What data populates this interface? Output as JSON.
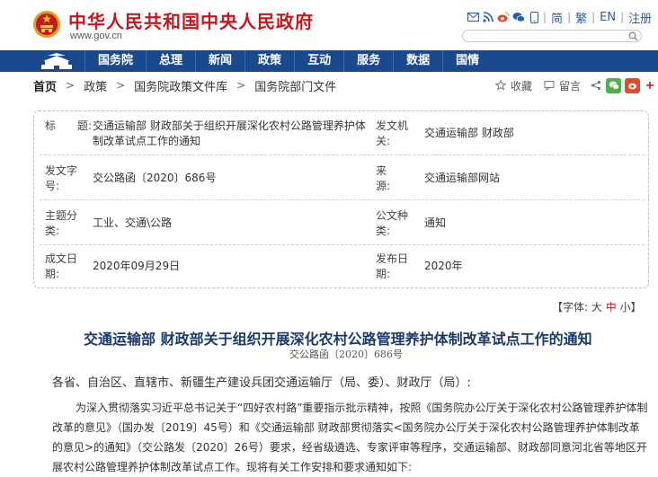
{
  "header": {
    "site_title": "中华人民共和国中央人民政府",
    "site_url": "www.gov.cn",
    "links": {
      "simplified": "简",
      "traditional": "繁",
      "english": "EN",
      "register": "注册"
    },
    "icons": [
      "mail-icon",
      "rss-icon",
      "weibo-icon",
      "wechat-icon",
      "mobile-icon"
    ]
  },
  "nav": {
    "items": [
      "国务院",
      "总理",
      "新闻",
      "政策",
      "互动",
      "服务",
      "数据",
      "国情"
    ]
  },
  "breadcrumb": {
    "home": "首页",
    "items": [
      "政策",
      "国务院政策文件库",
      "国务院部门文件"
    ]
  },
  "actions": {
    "favorite": "收藏",
    "comment": "留言"
  },
  "info": {
    "title_label": "标　　题:",
    "title_value_line1": "交通运输部 财政部关于组织开展深化农村公路管理养护体",
    "title_value_line2": "制改革试点工作的通知",
    "issuer_label_line1": "发文机",
    "issuer_label_line2": "关:",
    "issuer_value": "交通运输部 财政部",
    "docno_label_line1": "发文字",
    "docno_label_line2": "号:",
    "docno_value": "交公路函〔2020〕686号",
    "source_label_line1": "来　　",
    "source_label_line2": "源:",
    "source_value": "交通运输部网站",
    "topic_label_line1": "主题分",
    "topic_label_line2": "类:",
    "topic_value": "工业、交通\\公路",
    "genre_label_line1": "公文种",
    "genre_label_line2": "类:",
    "genre_value": "通知",
    "created_label_line1": "成文日",
    "created_label_line2": "期:",
    "created_value": "2020年09月29日",
    "published_label_line1": "发布日",
    "published_label_line2": "期:",
    "published_value": "2020年"
  },
  "fontbar": {
    "prefix": "【字体:",
    "large": "大",
    "medium": "中",
    "small": "小】"
  },
  "article": {
    "title": "交通运输部 财政部关于组织开展深化农村公路管理养护体制改革试点工作的通知",
    "docno": "交公路函〔2020〕686号",
    "greeting": "各省、自治区、直辖市、新疆生产建设兵团交通运输厅（局、委）、财政厅（局）:",
    "paragraph": "为深入贯彻落实习近平总书记关于“四好农村路”重要指示批示精神，按照《国务院办公厅关于深化农村公路管理养护体制改革的意见》（国办发〔2019〕45号）和《交通运输部 财政部贯彻落实<国务院办公厅关于深化农村公路管理养护体制改革的意见>的通知》（交公路发〔2020〕26号）要求，经省级遴选、专家评审等程序，交通运输部、财政部同意河北省等地区开展农村公路管理养护体制改革试点工作。现将有关工作安排和要求通知如下:"
  },
  "colors": {
    "brand_red": "#c8161d",
    "nav_blue": "#1a4a8d",
    "link_blue": "#2a5da8",
    "title_navy": "#1a3a6e"
  }
}
